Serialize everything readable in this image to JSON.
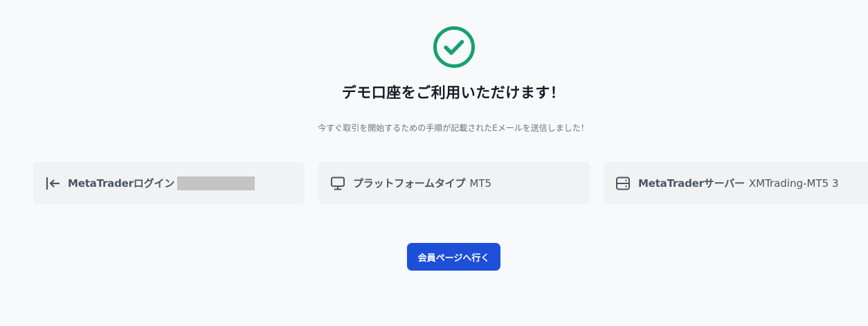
{
  "header": {
    "success_icon": "check-circle-icon",
    "title": "デモ口座をご利用いただけます！",
    "subtitle": "今すぐ取引を開始するための手順が記載されたEメールを送信しました！"
  },
  "cards": {
    "login": {
      "icon": "login-arrow-icon",
      "label": "MetaTraderログイン"
    },
    "platform": {
      "icon": "monitor-icon",
      "label": "プラットフォームタイプ",
      "value": "MT5"
    },
    "server": {
      "icon": "server-icon",
      "label": "MetaTraderサーバー",
      "value": "XMTrading-MT5 3"
    }
  },
  "actions": {
    "members_page_label": "会員ページへ行く"
  },
  "colors": {
    "success": "#16a070",
    "primary": "#1d4fd8",
    "background": "#f8f9fb",
    "card": "#f1f2f4"
  }
}
